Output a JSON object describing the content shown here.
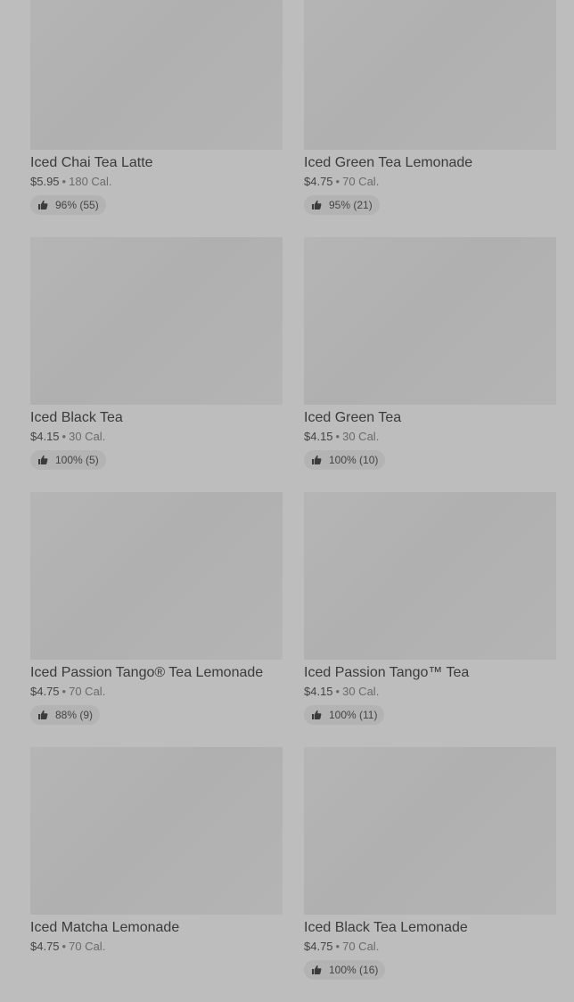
{
  "items": [
    {
      "name": "Iced Chai Tea Latte",
      "price": "$5.95",
      "calories": "180 Cal.",
      "rating": "96% (55)"
    },
    {
      "name": "Iced Green Tea Lemonade",
      "price": "$4.75",
      "calories": "70 Cal.",
      "rating": "95% (21)"
    },
    {
      "name": "Iced Black Tea",
      "price": "$4.15",
      "calories": "30 Cal.",
      "rating": "100% (5)"
    },
    {
      "name": "Iced Green Tea",
      "price": "$4.15",
      "calories": "30 Cal.",
      "rating": "100% (10)"
    },
    {
      "name": "Iced Passion Tango® Tea Lemonade",
      "price": "$4.75",
      "calories": "70 Cal.",
      "rating": "88% (9)"
    },
    {
      "name": "Iced Passion Tango™ Tea",
      "price": "$4.15",
      "calories": "30 Cal.",
      "rating": "100% (11)"
    },
    {
      "name": "Iced Matcha Lemonade",
      "price": "$4.75",
      "calories": "70 Cal.",
      "rating": null
    },
    {
      "name": "Iced Black Tea Lemonade",
      "price": "$4.75",
      "calories": "70 Cal.",
      "rating": "100% (16)"
    }
  ],
  "separator": "•",
  "icons": {
    "rating": "thumbs-up-icon"
  },
  "colors": {
    "overlay": "#bdbdbd",
    "thumbnail": "#b3b3b3",
    "text": "#3b3b3b"
  }
}
